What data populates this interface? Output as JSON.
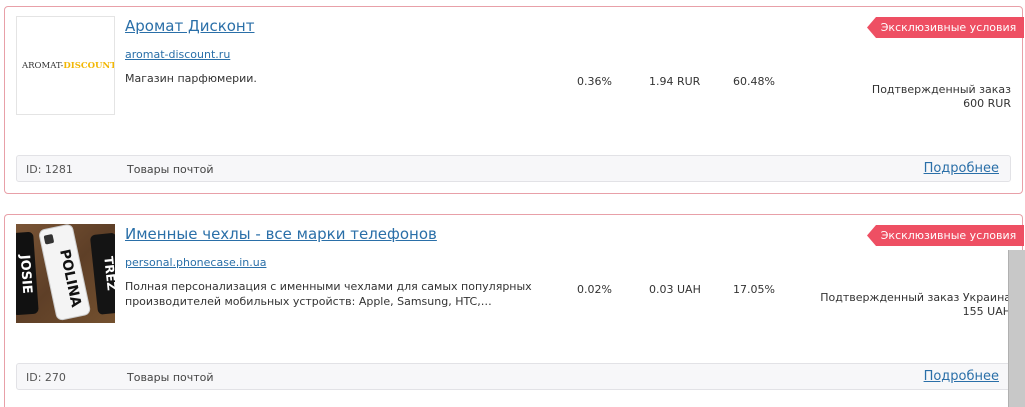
{
  "offers": [
    {
      "title": "Аромат Дисконт",
      "domain": "aromat-discount.ru",
      "description": "Магазин парфюмерии.",
      "metric_1": "0.36%",
      "metric_2": "1.94 RUR",
      "metric_3": "60.48%",
      "badge": "Эксклюзивные условия",
      "payout_line_1": "Подтвержденный заказ",
      "payout_line_2": "600 RUR",
      "id_label": "ID: 1281",
      "type": "Товары почтой",
      "more_link": "Подробнее",
      "logo": {
        "text_dark": "AROMAT-",
        "text_accent": "DISCOUNT",
        "accent_color": "#f2b705"
      }
    },
    {
      "title": "Именные чехлы - все марки телефонов",
      "domain": "personal.phonecase.in.ua",
      "description": "Полная персонализация с именными чехлами для самых популярных производителей мобильных устройств: Apple, Samsung, HTC,…",
      "metric_1": "0.02%",
      "metric_2": "0.03 UAH",
      "metric_3": "17.05%",
      "badge": "Эксклюзивные условия",
      "payout_line_1": "Подтвержденный заказ Украина",
      "payout_line_2": "155 UAH",
      "id_label": "ID: 270",
      "type": "Товары почтой",
      "more_link": "Подробнее",
      "logo": {
        "case_text_left": "JOSIE",
        "case_text_center": "POLINA",
        "case_text_right": "TREZ"
      }
    }
  ],
  "colors": {
    "link": "#2a6fa8",
    "badge": "#ee4f63",
    "card_border": "#e8a0a8"
  }
}
